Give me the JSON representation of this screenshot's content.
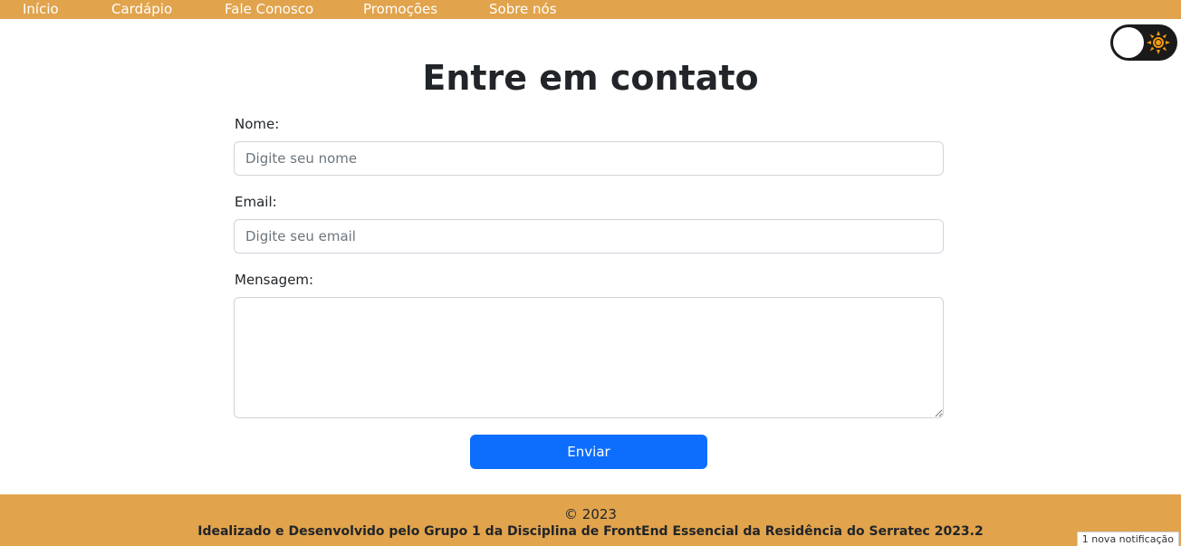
{
  "nav": {
    "items": [
      {
        "label": "Início"
      },
      {
        "label": "Cardápio"
      },
      {
        "label": "Fale Conosco"
      },
      {
        "label": "Promoções"
      },
      {
        "label": "Sobre nós"
      }
    ]
  },
  "theme_toggle": {
    "state": "light",
    "icon": "sun-icon"
  },
  "main": {
    "title": "Entre em contato",
    "form": {
      "name_label": "Nome:",
      "name_placeholder": "Digite seu nome",
      "name_value": "",
      "email_label": "Email:",
      "email_placeholder": "Digite seu email",
      "email_value": "",
      "message_label": "Mensagem:",
      "message_value": "",
      "submit_label": "Enviar"
    }
  },
  "footer": {
    "copyright": "© 2023",
    "credit": "Idealizado e Desenvolvido pelo Grupo 1 da Disciplina de FrontEnd Essencial da Residência do Serratec 2023.2"
  },
  "notification": {
    "text": "1 nova notificação"
  },
  "colors": {
    "accent": "#e1a34c",
    "primary_button": "#0d6efd",
    "sun": "#f39c12"
  }
}
